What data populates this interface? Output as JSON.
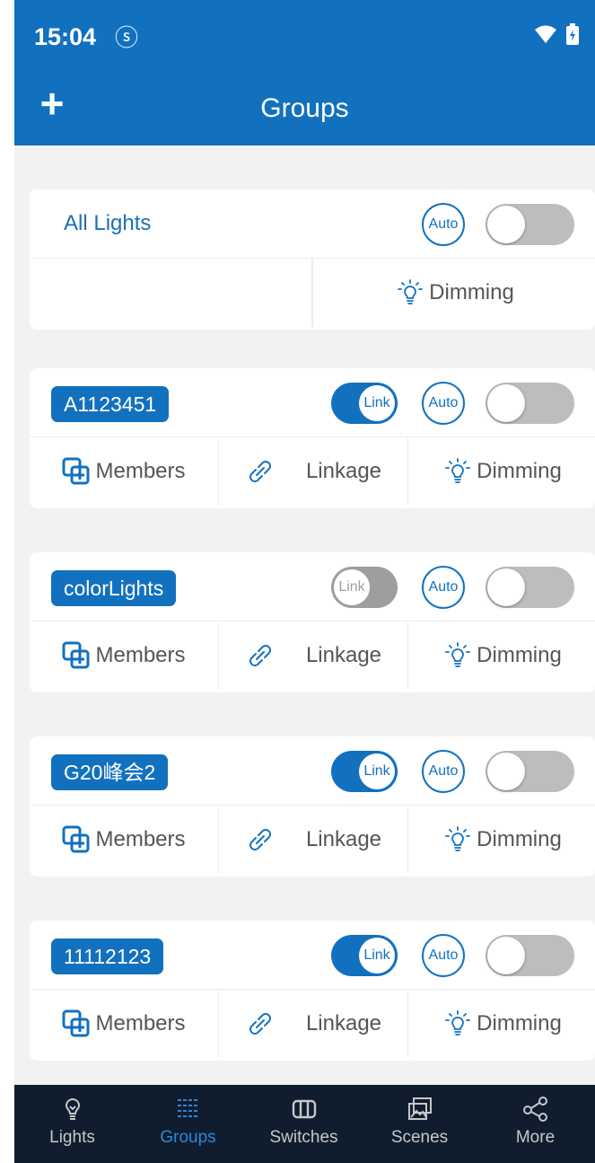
{
  "status_bar": {
    "time": "15:04",
    "extra_icon": "ⓢ"
  },
  "app_bar": {
    "add_label": "+",
    "title": "Groups"
  },
  "all_lights": {
    "name": "All Lights",
    "auto_label": "Auto",
    "dimming_label": "Dimming"
  },
  "groups": [
    {
      "name": "A1123451",
      "link_label": "Link",
      "link_on": true,
      "auto_label": "Auto",
      "members_label": "Members",
      "linkage_label": "Linkage",
      "dimming_label": "Dimming"
    },
    {
      "name": "colorLights",
      "link_label": "Link",
      "link_on": false,
      "auto_label": "Auto",
      "members_label": "Members",
      "linkage_label": "Linkage",
      "dimming_label": "Dimming"
    },
    {
      "name": "G20峰会2",
      "link_label": "Link",
      "link_on": true,
      "auto_label": "Auto",
      "members_label": "Members",
      "linkage_label": "Linkage",
      "dimming_label": "Dimming"
    },
    {
      "name": "11112123",
      "link_label": "Link",
      "link_on": true,
      "auto_label": "Auto",
      "members_label": "Members",
      "linkage_label": "Linkage",
      "dimming_label": "Dimming"
    }
  ],
  "tabs": [
    {
      "label": "Lights",
      "icon": "bulb-icon",
      "active": false
    },
    {
      "label": "Groups",
      "icon": "groups-icon",
      "active": true
    },
    {
      "label": "Switches",
      "icon": "switch-icon",
      "active": false
    },
    {
      "label": "Scenes",
      "icon": "scenes-icon",
      "active": false
    },
    {
      "label": "More",
      "icon": "share-icon",
      "active": false
    }
  ],
  "colors": {
    "primary": "#1271bf",
    "tab_active": "#2d86d6",
    "tab_bar_bg": "#0f1d2e"
  }
}
